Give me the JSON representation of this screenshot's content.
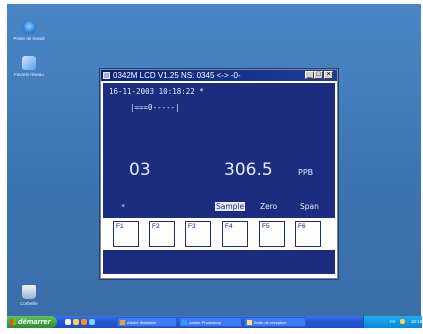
{
  "desktop": {
    "icons": [
      {
        "label": "Poste de travail",
        "icon": "computer-icon"
      },
      {
        "label": "Favoris réseau",
        "icon": "network-icon"
      },
      {
        "label": "Corbeille",
        "icon": "recycle-bin-icon"
      }
    ]
  },
  "window": {
    "title": "0342M LCD V1.25  NS: 0345 <-> -0-",
    "controls": {
      "minimize": "_",
      "maximize": "□",
      "close": "×"
    }
  },
  "lcd": {
    "datetime": "16-11-2003  10:18:22  *",
    "bar": "|===0-----|",
    "channel": "03",
    "value": "306.5",
    "unit": "PPB",
    "cursor": "*",
    "softkeys": [
      "Sample",
      "Zero",
      "Span"
    ],
    "active_softkey": "Sample"
  },
  "function_keys": [
    "F1",
    "F2",
    "F3",
    "F4",
    "F5",
    "F6"
  ],
  "taskbar": {
    "start_label": "démarrer",
    "buttons": [
      {
        "label": "Adobe Illustrator",
        "icon": "illustrator-icon"
      },
      {
        "label": "Adobe Photoshop",
        "icon": "photoshop-icon"
      },
      {
        "label": "Boîte de réception",
        "icon": "mail-icon"
      }
    ],
    "tray_lang": "FR",
    "clock": "10:18"
  },
  "colors": {
    "desktop": "#3f78b8",
    "lcd_bg": "#1c2c7f",
    "lcd_fg": "#e6ebff",
    "titlebar": "#0b2577",
    "taskbar": "#2458d8",
    "start": "#3b9a3a"
  }
}
